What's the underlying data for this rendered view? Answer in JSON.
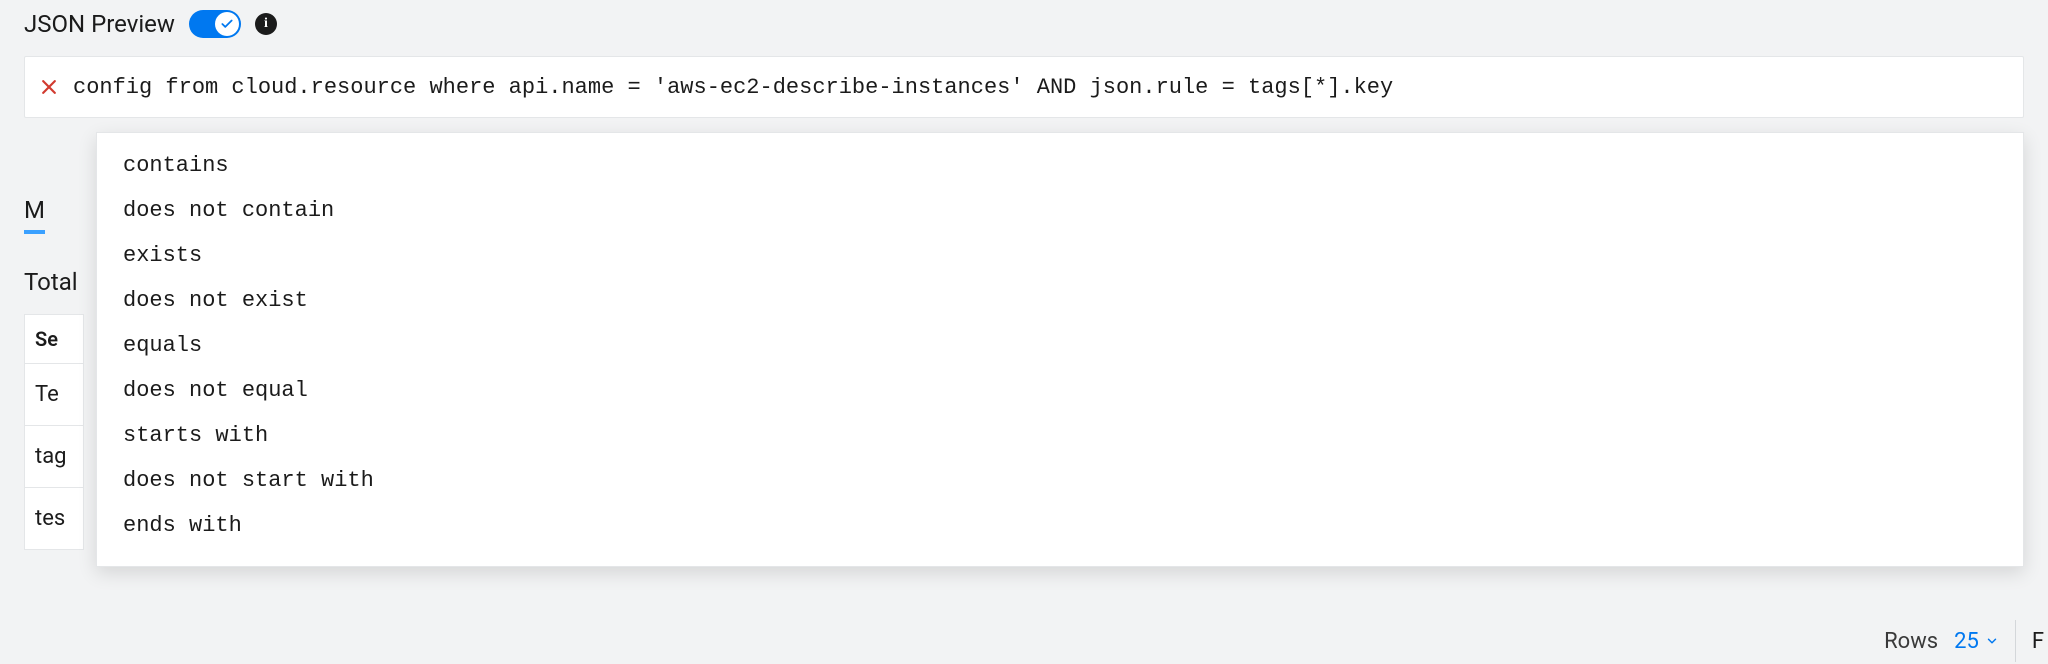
{
  "header": {
    "title": "JSON Preview",
    "toggle_on": true,
    "info_icon_label": "i"
  },
  "query": {
    "text": "config from cloud.resource where api.name = 'aws-ec2-describe-instances' AND json.rule = tags[*].key"
  },
  "autocomplete": {
    "items": [
      "contains",
      "does not contain",
      "exists",
      "does not exist",
      "equals",
      "does not equal",
      "starts with",
      "does not start with",
      "ends with"
    ]
  },
  "tabs": {
    "active_fragment": "M"
  },
  "results": {
    "total_label_fragment": "Total",
    "header_fragment": "Se",
    "rows": [
      "Te",
      "tag",
      "tes"
    ]
  },
  "footer": {
    "rows_label": "Rows",
    "rows_value": "25",
    "page_fragment": "F"
  }
}
